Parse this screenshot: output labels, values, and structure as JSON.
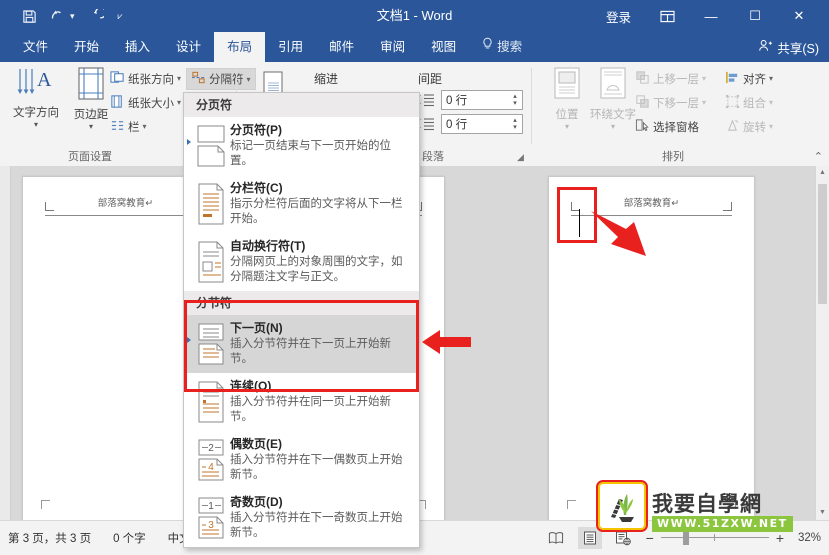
{
  "titlebar": {
    "doc_title": "文档1  -  Word",
    "quick_access": [
      {
        "name": "save-icon",
        "glyph": "💾"
      },
      {
        "name": "undo-icon",
        "glyph": "↶"
      },
      {
        "name": "redo-icon",
        "glyph": "↻"
      },
      {
        "name": "customize-qat-icon",
        "glyph": "⨇"
      }
    ],
    "signin_label": "登录",
    "ribbon_display_label": "⬚",
    "minimize_label": "—",
    "maximize_label": "☐",
    "close_label": "✕"
  },
  "tabs": [
    {
      "label": "文件",
      "active": false
    },
    {
      "label": "开始",
      "active": false
    },
    {
      "label": "插入",
      "active": false
    },
    {
      "label": "设计",
      "active": false
    },
    {
      "label": "布局",
      "active": true
    },
    {
      "label": "引用",
      "active": false
    },
    {
      "label": "邮件",
      "active": false
    },
    {
      "label": "审阅",
      "active": false
    },
    {
      "label": "视图",
      "active": false
    }
  ],
  "tell_me": "搜索",
  "share_label": "共享(S)",
  "ribbon": {
    "groups": [
      {
        "name": "page-setup",
        "title": "页面设置",
        "big_buttons": [
          {
            "label": "文字方向",
            "icon": "text-direction-icon"
          },
          {
            "label": "页边距",
            "icon": "margins-icon"
          }
        ],
        "small_buttons": [
          {
            "label": "纸张方向",
            "icon": "orientation-icon",
            "dim": false
          },
          {
            "label": "纸张大小",
            "icon": "paper-size-icon",
            "dim": false
          },
          {
            "label": "栏",
            "icon": "columns-icon",
            "dim": false
          }
        ],
        "split_button": {
          "label": "分隔符",
          "icon": "breaks-icon",
          "pressed": true
        }
      },
      {
        "name": "paragraph",
        "title": "段落",
        "indent_label": "缩进",
        "spacing_label": "间距",
        "line_numbers_icon": "line-numbers-icon",
        "spin_before": "0 行",
        "spin_after": "0 行"
      },
      {
        "name": "arrange",
        "title": "排列",
        "big_buttons": [
          {
            "label": "位置",
            "icon": "position-icon"
          },
          {
            "label": "环绕文字",
            "icon": "wrap-text-icon"
          }
        ],
        "small_buttons": [
          {
            "label": "上移一层",
            "icon": "bring-forward-icon",
            "dim": true
          },
          {
            "label": "下移一层",
            "icon": "send-backward-icon",
            "dim": true
          },
          {
            "label": "选择窗格",
            "icon": "selection-pane-icon",
            "dim": false
          },
          {
            "label": "对齐",
            "icon": "align-icon",
            "dim": false
          },
          {
            "label": "组合",
            "icon": "group-icon",
            "dim": true
          },
          {
            "label": "旋转",
            "icon": "rotate-icon",
            "dim": true
          }
        ]
      }
    ],
    "collapse_label": "⌃"
  },
  "breaks_menu": {
    "sections": [
      {
        "header": "分页符",
        "items": [
          {
            "title": "分页符(P)",
            "desc": "标记一页结束与下一页开始的位置。",
            "icon": "page-break-icon",
            "selected": false,
            "bullet": true
          },
          {
            "title": "分栏符(C)",
            "desc": "指示分栏符后面的文字将从下一栏开始。",
            "icon": "column-break-icon",
            "selected": false,
            "bullet": false
          },
          {
            "title": "自动换行符(T)",
            "desc": "分隔网页上的对象周围的文字，如分隔题注文字与正文。",
            "icon": "text-wrapping-icon",
            "selected": false,
            "bullet": false
          }
        ]
      },
      {
        "header": "分节符",
        "items": [
          {
            "title": "下一页(N)",
            "desc": "插入分节符并在下一页上开始新节。",
            "icon": "next-page-section-icon",
            "selected": true,
            "bullet": true
          },
          {
            "title": "连续(O)",
            "desc": "插入分节符并在同一页上开始新节。",
            "icon": "continuous-section-icon",
            "selected": false,
            "bullet": false
          },
          {
            "title": "偶数页(E)",
            "desc": "插入分节符并在下一偶数页上开始新节。",
            "icon": "even-page-section-icon",
            "selected": false,
            "bullet": false
          },
          {
            "title": "奇数页(D)",
            "desc": "插入分节符并在下一奇数页上开始新节。",
            "icon": "odd-page-section-icon",
            "selected": false,
            "bullet": false
          }
        ]
      }
    ]
  },
  "document": {
    "pages": [
      {
        "header_text": "部落窝教育↵",
        "has_caret": false
      },
      {
        "header_text": "部落窝教育↵",
        "has_caret": false
      },
      {
        "header_text": "部落窝教育↵",
        "has_caret": true
      }
    ]
  },
  "status": {
    "page_info": "第 3 页，共 3 页",
    "word_count": "0 个字",
    "language": "中文",
    "views": [
      {
        "name": "read-mode",
        "glyph": "📖",
        "selected": false
      },
      {
        "name": "print-layout",
        "glyph": "☰",
        "selected": true
      },
      {
        "name": "web-layout",
        "glyph": "🌐",
        "selected": false
      }
    ],
    "zoom_out_label": "−",
    "zoom_in_label": "+",
    "zoom_percent": "32%"
  },
  "watermark": {
    "title": "我要自學網",
    "url": "WWW.51ZXW.NET"
  },
  "colors": {
    "accent": "#2b579a",
    "ribbon_bg": "#f3f3f3",
    "highlight_red": "#e8201e",
    "doc_bg": "#d8d8d8",
    "menu_selected": "#d6d6d6",
    "watermark_green": "#8cc63e"
  }
}
